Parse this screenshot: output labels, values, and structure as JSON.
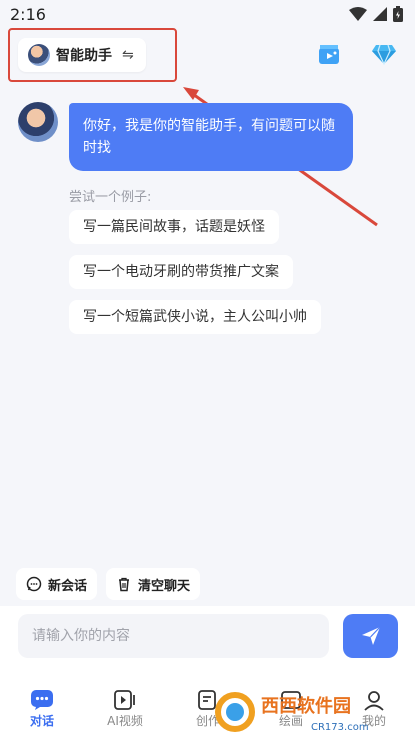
{
  "status": {
    "time": "2:16"
  },
  "header": {
    "assistant_name": "智能助手",
    "switch_glyph": "⇋"
  },
  "chat": {
    "greeting": "你好，我是你的智能助手，有问题可以随时找",
    "examples_title": "尝试一个例子:",
    "examples": [
      "写一篇民间故事，话题是妖怪",
      "写一个电动牙刷的带货推广文案",
      "写一个短篇武侠小说，主人公叫小帅"
    ]
  },
  "actions": {
    "new_chat": "新会话",
    "clear_chat": "清空聊天"
  },
  "input": {
    "placeholder": "请输入你的内容"
  },
  "tabs": [
    {
      "label": "对话",
      "active": true
    },
    {
      "label": "AI视频",
      "active": false
    },
    {
      "label": "创作",
      "active": false
    },
    {
      "label": "绘画",
      "active": false
    },
    {
      "label": "我的",
      "active": false
    }
  ],
  "watermark": {
    "text": "西西软件园",
    "sub": "CR173.com"
  },
  "colors": {
    "accent": "#4e7cf5",
    "highlight": "#d9483b"
  }
}
